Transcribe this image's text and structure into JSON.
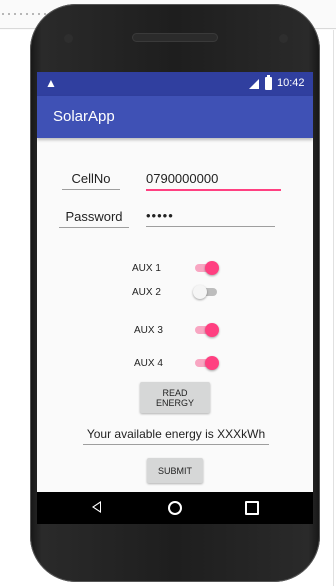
{
  "status_bar": {
    "time": "10:42",
    "warning_icon": "warning-icon",
    "signal_icon": "signal-icon",
    "battery_icon": "battery-icon"
  },
  "app_bar": {
    "title": "SolarApp"
  },
  "form": {
    "cell_label": "CellNo",
    "cell_value": "0790000000",
    "password_label": "Password",
    "password_value": "•••••"
  },
  "aux": [
    {
      "label": "AUX 1",
      "state": "on"
    },
    {
      "label": "AUX 2",
      "state": "off"
    },
    {
      "label": "AUX 3",
      "state": "on"
    },
    {
      "label": "AUX 4",
      "state": "on"
    }
  ],
  "read_energy_button": {
    "line1": "READ",
    "line2": "ENERGY"
  },
  "energy_text": "Your available energy is XXXkWh",
  "submit_button": "SUBMIT",
  "nav": {
    "back": "back-icon",
    "home": "home-icon",
    "recents": "recents-icon"
  },
  "colors": {
    "primary": "#3f51b5",
    "primary_dark": "#303f9f",
    "accent": "#ff4081"
  }
}
